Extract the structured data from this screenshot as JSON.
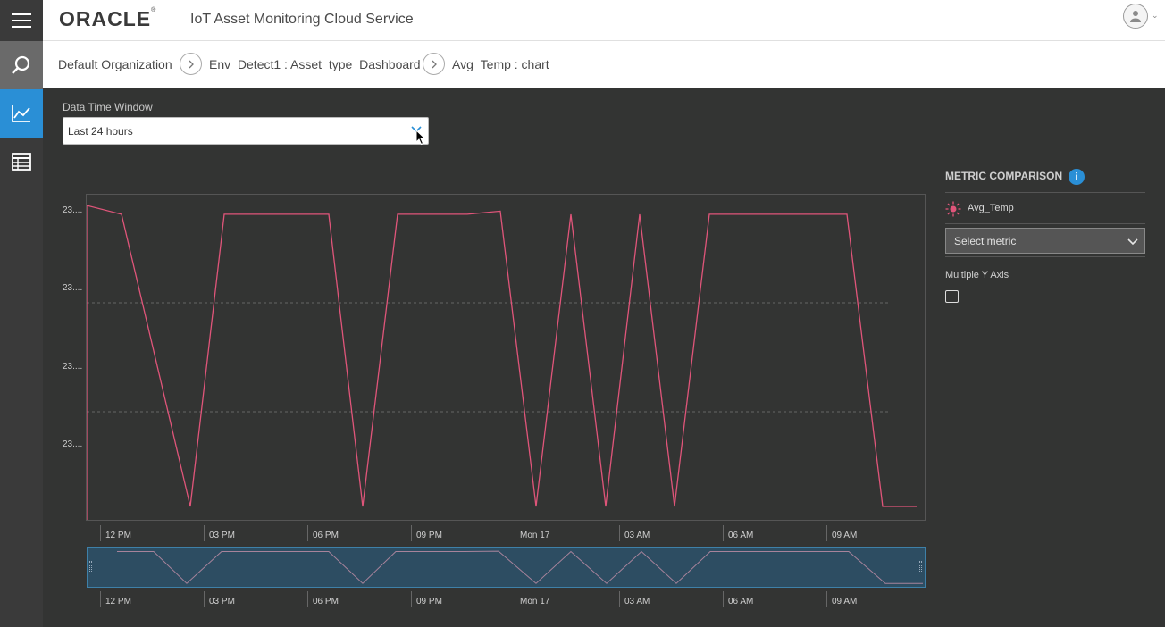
{
  "header": {
    "logo_text": "ORACLE",
    "logo_mark": "®",
    "app_title": "IoT Asset Monitoring Cloud Service"
  },
  "sidenav": {
    "items": [
      {
        "icon": "search-icon"
      },
      {
        "icon": "line-chart-icon",
        "active": true
      },
      {
        "icon": "table-icon"
      }
    ]
  },
  "breadcrumb": {
    "items": [
      "Default Organization",
      "Env_Detect1 : Asset_type_Dashboard",
      "Avg_Temp : chart"
    ]
  },
  "time_window": {
    "label": "Data Time Window",
    "value": "Last 24 hours"
  },
  "metric_panel": {
    "title": "METRIC COMPARISON",
    "info_glyph": "i",
    "metric_name": "Avg_Temp",
    "metric_color": "#e0557a",
    "select_placeholder": "Select metric",
    "multiple_y_label": "Multiple Y Axis",
    "multiple_y_checked": false
  },
  "colors": {
    "accent": "#2a8fd6",
    "series": "#e0557a",
    "background": "#333433"
  },
  "chart_data": {
    "type": "line",
    "ytick_labels": [
      "23....",
      "23....",
      "23....",
      "23...."
    ],
    "ylim": [
      0,
      1
    ],
    "grid": "horizontal dashed",
    "x_labels": [
      "12 PM",
      "03 PM",
      "06 PM",
      "09 PM",
      "Mon 17",
      "03 AM",
      "06 AM",
      "09 AM"
    ],
    "x": [
      0,
      1,
      2,
      3,
      4,
      5,
      6,
      7,
      8,
      9,
      10,
      11,
      12,
      13,
      14,
      15,
      16,
      17,
      18,
      19,
      20,
      21
    ],
    "series": [
      {
        "values": [
          0.96,
          0.96,
          0.02,
          0.96,
          0.96,
          0.02,
          0.96,
          0.96,
          0.97,
          0.02,
          0.96,
          0.02,
          0.96,
          0.02,
          0.96,
          0.96,
          0.96,
          0.96,
          0.02,
          0.02,
          0.02,
          0.02
        ]
      }
    ]
  }
}
